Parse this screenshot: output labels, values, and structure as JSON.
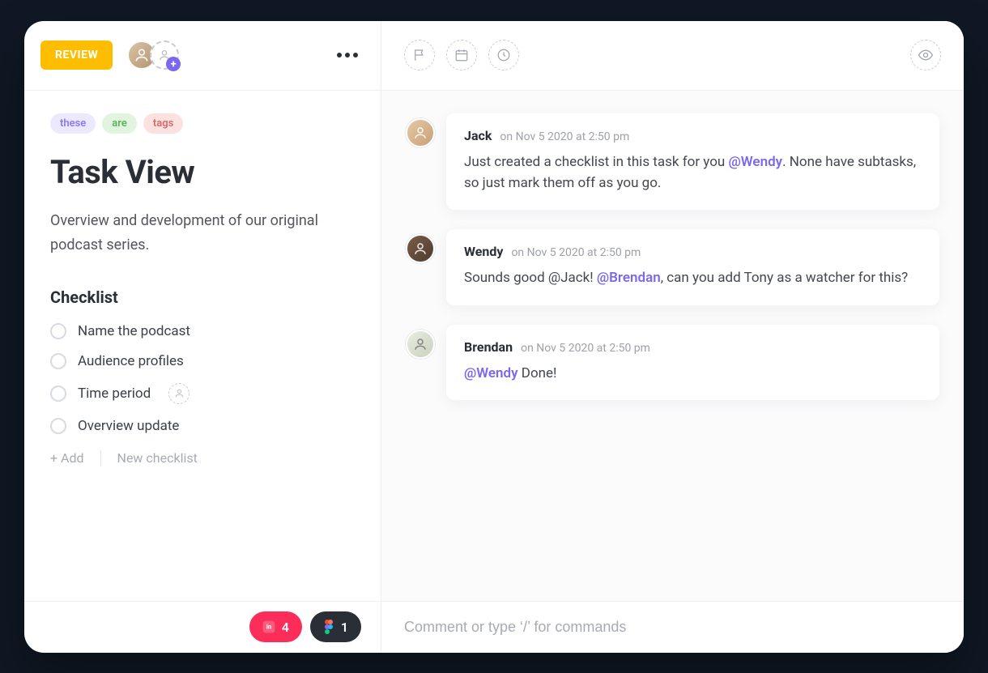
{
  "status_label": "REVIEW",
  "tags": [
    "these",
    "are",
    "tags"
  ],
  "task_title": "Task View",
  "task_description": "Overview and development of our original podcast series.",
  "checklist": {
    "heading": "Checklist",
    "items": [
      {
        "label": "Name the podcast"
      },
      {
        "label": "Audience profiles"
      },
      {
        "label": "Time period"
      },
      {
        "label": "Overview update"
      }
    ],
    "add_label": "+ Add",
    "new_label": "New checklist"
  },
  "attachments": {
    "invision_count": "4",
    "figma_count": "1"
  },
  "comments": [
    {
      "author": "Jack",
      "timestamp": "on Nov 5 2020 at 2:50 pm",
      "body_pre": "Just created a checklist in this task for you ",
      "mention": "@Wendy",
      "body_post": ". None have subtasks, so just mark them off as you go."
    },
    {
      "author": "Wendy",
      "timestamp": "on Nov 5 2020 at 2:50 pm",
      "body_pre": "Sounds good @Jack! ",
      "mention": "@Brendan",
      "body_post": ", can you add Tony as a watcher for this?"
    },
    {
      "author": "Brendan",
      "timestamp": "on Nov 5 2020 at 2:50 pm",
      "body_pre": "",
      "mention": "@Wendy",
      "body_post": " Done!"
    }
  ],
  "composer": {
    "placeholder": "Comment or type ‘/’ for commands"
  }
}
